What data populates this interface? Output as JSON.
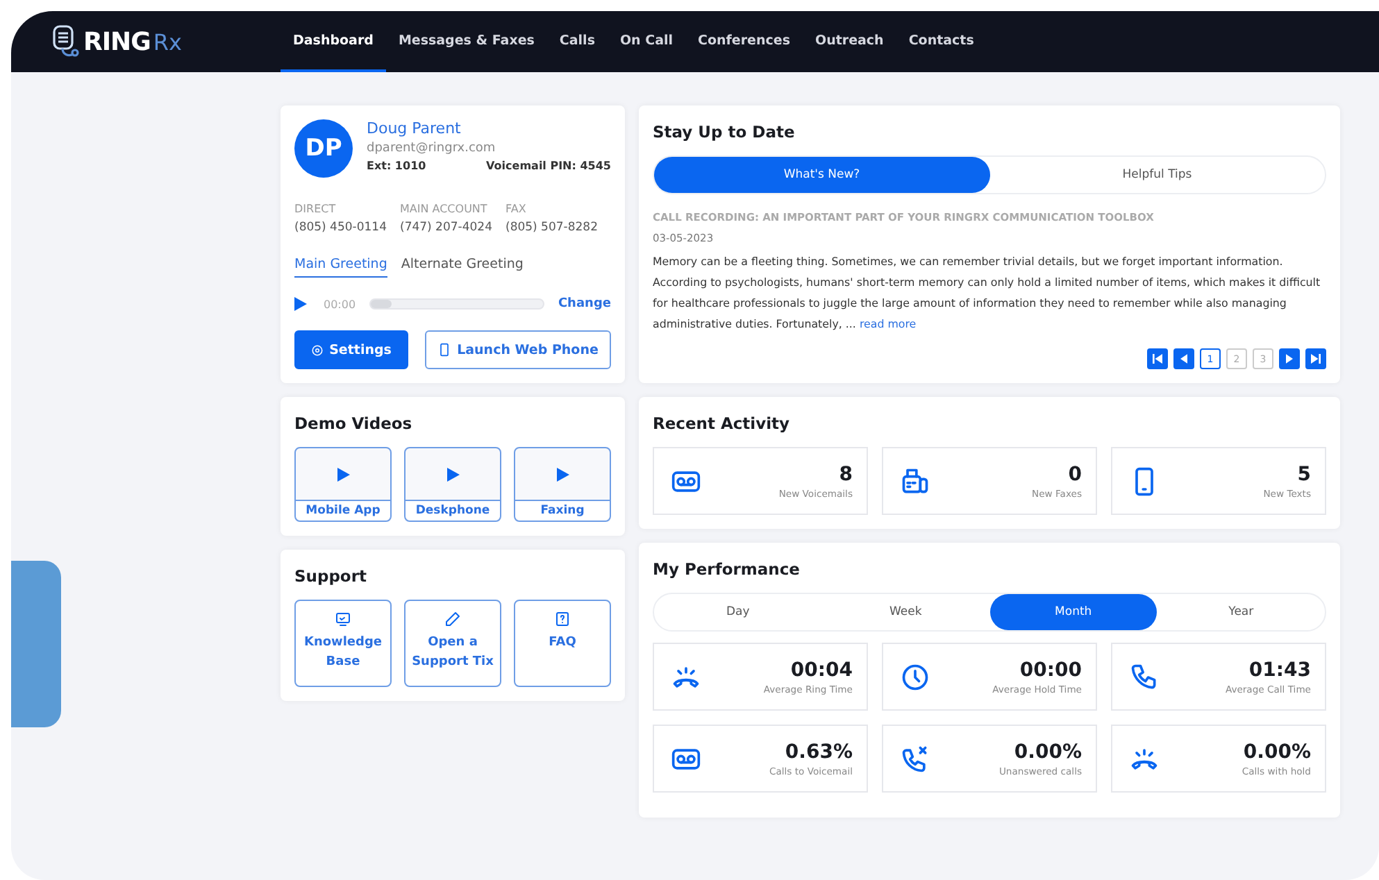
{
  "logo": {
    "main": "RING",
    "suffix": "Rx"
  },
  "nav": [
    {
      "label": "Dashboard",
      "selected": true
    },
    {
      "label": "Messages & Faxes",
      "selected": false
    },
    {
      "label": "Calls",
      "selected": false
    },
    {
      "label": "On Call",
      "selected": false
    },
    {
      "label": "Conferences",
      "selected": false
    },
    {
      "label": "Outreach",
      "selected": false
    },
    {
      "label": "Contacts",
      "selected": false
    }
  ],
  "profile": {
    "initials": "DP",
    "name": "Doug Parent",
    "email": "dparent@ringrx.com",
    "ext": "Ext: 1010",
    "pin": "Voicemail PIN: 4545",
    "numbers": [
      {
        "label": "DIRECT",
        "value": "(805) 450-0114"
      },
      {
        "label": "MAIN ACCOUNT",
        "value": "(747) 207-4024"
      },
      {
        "label": "FAX",
        "value": "(805) 507-8282"
      }
    ],
    "greetings": [
      {
        "label": "Main Greeting",
        "selected": true
      },
      {
        "label": "Alternate Greeting",
        "selected": false
      }
    ],
    "player": {
      "time": "00:00",
      "level": 0.12,
      "change": "Change"
    },
    "buttons": [
      {
        "label": "Settings",
        "kind": "primary"
      },
      {
        "label": "Launch Web Phone",
        "kind": "outline"
      }
    ]
  },
  "demo_videos": {
    "title": "Demo Videos",
    "items": [
      "Mobile App",
      "Deskphone",
      "Faxing"
    ]
  },
  "support": {
    "title": "Support",
    "items": [
      {
        "label": "Knowledge Base",
        "kind": "screen"
      },
      {
        "label": "Open a Support Tix",
        "kind": "pencil"
      },
      {
        "label": "FAQ",
        "kind": "question"
      }
    ]
  },
  "news": {
    "title": "Stay Up to Date",
    "tabs": [
      {
        "label": "What's New?",
        "selected": true
      },
      {
        "label": "Helpful Tips",
        "selected": false
      }
    ],
    "headline": "CALL RECORDING: AN IMPORTANT PART OF YOUR RINGRX COMMUNICATION TOOLBOX",
    "date": "03-05-2023",
    "body": "Memory can be a fleeting thing. Sometimes, we can remember trivial details, but we forget important information. According to psychologists, humans' short-term memory can only hold a limited number of items, which makes it difficult for healthcare professionals to juggle the large amount of information they need to remember while also managing administrative duties. Fortunately, ...",
    "read_more": "read more",
    "pages": [
      {
        "label": "1",
        "selected": true
      },
      {
        "label": "2",
        "selected": false
      },
      {
        "label": "3",
        "selected": false
      }
    ]
  },
  "recent_activity": {
    "title": "Recent Activity",
    "items": [
      {
        "kind": "voicemail",
        "value": "8",
        "label": "New Voicemails"
      },
      {
        "kind": "fax",
        "value": "0",
        "label": "New Faxes"
      },
      {
        "kind": "text",
        "value": "5",
        "label": "New Texts"
      }
    ]
  },
  "performance": {
    "title": "My Performance",
    "periods": [
      {
        "label": "Day",
        "selected": false
      },
      {
        "label": "Week",
        "selected": false
      },
      {
        "label": "Month",
        "selected": true
      },
      {
        "label": "Year",
        "selected": false
      }
    ],
    "stats": [
      {
        "kind": "ring",
        "value": "00:04",
        "label": "Average Ring Time"
      },
      {
        "kind": "clock",
        "value": "00:00",
        "label": "Average Hold Time"
      },
      {
        "kind": "phone",
        "value": "01:43",
        "label": "Average Call Time"
      },
      {
        "kind": "voicemail",
        "value": "0.63%",
        "label": "Calls to Voicemail"
      },
      {
        "kind": "missed",
        "value": "0.00%",
        "label": "Unanswered calls"
      },
      {
        "kind": "ring",
        "value": "0.00%",
        "label": "Calls with hold"
      }
    ]
  }
}
